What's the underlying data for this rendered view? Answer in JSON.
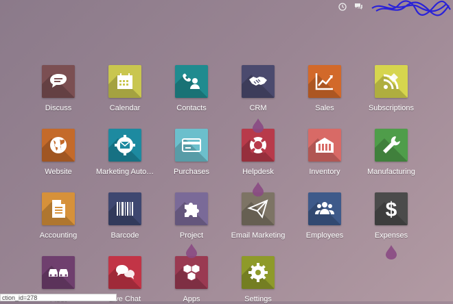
{
  "topbar": {
    "icons": [
      "clock-icon",
      "chat-icon"
    ]
  },
  "apps": [
    {
      "label": "Discuss",
      "color": "#7b4f52",
      "icon": "chat-bubble-icon"
    },
    {
      "label": "Calendar",
      "color": "#c9c64f",
      "icon": "calendar-icon"
    },
    {
      "label": "Contacts",
      "color": "#1f8b8f",
      "icon": "contact-phone-icon"
    },
    {
      "label": "CRM",
      "color": "#4b4a6e",
      "icon": "handshake-icon"
    },
    {
      "label": "Sales",
      "color": "#d2692a",
      "icon": "line-chart-icon"
    },
    {
      "label": "Subscriptions",
      "color": "#d6d54e",
      "icon": "rss-pencil-icon"
    },
    {
      "label": "Website",
      "color": "#c46a2a",
      "icon": "globe-icon"
    },
    {
      "label": "Marketing Auto…",
      "color": "#1d8aa0",
      "icon": "envelope-gear-icon"
    },
    {
      "label": "Purchases",
      "color": "#6cbfcc",
      "icon": "credit-card-icon"
    },
    {
      "label": "Helpdesk",
      "color": "#b83a4a",
      "icon": "lifebuoy-icon"
    },
    {
      "label": "Inventory",
      "color": "#d86a66",
      "icon": "warehouse-icon"
    },
    {
      "label": "Manufacturing",
      "color": "#4f9d4a",
      "icon": "wrench-icon"
    },
    {
      "label": "Accounting",
      "color": "#d6913a",
      "icon": "document-icon"
    },
    {
      "label": "Barcode",
      "color": "#3e4770",
      "icon": "barcode-icon"
    },
    {
      "label": "Project",
      "color": "#7a6a98",
      "icon": "puzzle-icon"
    },
    {
      "label": "Email Marketing",
      "color": "#7d7465",
      "icon": "paper-plane-icon"
    },
    {
      "label": "Employees",
      "color": "#3e5a8a",
      "icon": "users-icon"
    },
    {
      "label": "Expenses",
      "color": "#4b4b4b",
      "icon": "dollar-icon"
    },
    {
      "label": "Fleet",
      "color": "#6f3f6e",
      "icon": "cars-icon"
    },
    {
      "label": "Live Chat",
      "color": "#c23446",
      "icon": "chat-bubbles-icon"
    },
    {
      "label": "Apps",
      "color": "#9a3a52",
      "icon": "cubes-icon"
    },
    {
      "label": "Settings",
      "color": "#8e9a2a",
      "icon": "gear-icon"
    }
  ],
  "status_bar": {
    "text": "ction_id=278"
  }
}
